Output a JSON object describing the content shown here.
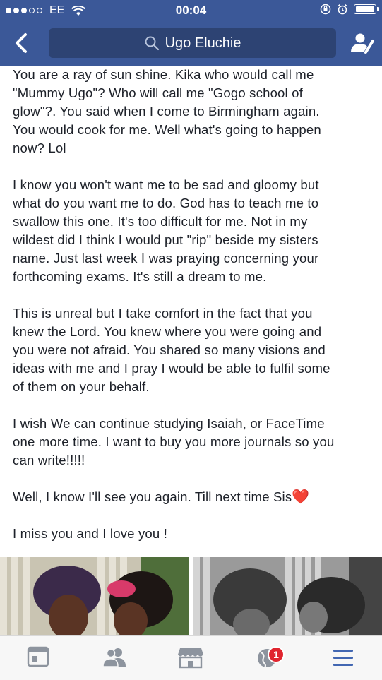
{
  "status_bar": {
    "carrier": "EE",
    "time": "00:04"
  },
  "header": {
    "search_label": "Ugo Eluchie"
  },
  "post": {
    "paragraphs": [
      "You are a ray of sun shine. Kika who would call me\n\"Mummy Ugo\"? Who will call me \"Gogo school of\nglow\"?. You said when I come to Birmingham again.\nYou would cook for me. Well what's going to happen\nnow? Lol",
      "I know you won't want me to be sad and gloomy but\nwhat do you want me to do. God has to teach me to\nswallow this one. It's too difficult for me. Not in my\nwildest did I think I would put \"rip\" beside my sisters\nname. Just last week I was praying concerning your\nforthcoming exams. It's still a dream to me.",
      "This is unreal but I take comfort in the fact that you\nknew the Lord. You knew where you were going and\nyou were not afraid. You shared so many visions and\nideas with me and I pray I would be able to fulfil some\nof them on your behalf.",
      "I wish We can continue studying Isaiah, or FaceTime\none more time. I want to buy you more journals so you\ncan write!!!!!",
      "Well, I know I'll see you again. Till next time Sis",
      "I miss you and I love you !"
    ],
    "emoji": "❤️"
  },
  "tab_bar": {
    "tabs": [
      "news-feed",
      "friends",
      "marketplace",
      "notifications",
      "menu"
    ],
    "notification_count": "1",
    "active_color": "#4267b2",
    "inactive_color": "#8d949e"
  },
  "colors": {
    "header_bg": "#3b5898",
    "search_bg": "#2d4373",
    "text": "#1d2129",
    "badge": "#e0252f"
  }
}
